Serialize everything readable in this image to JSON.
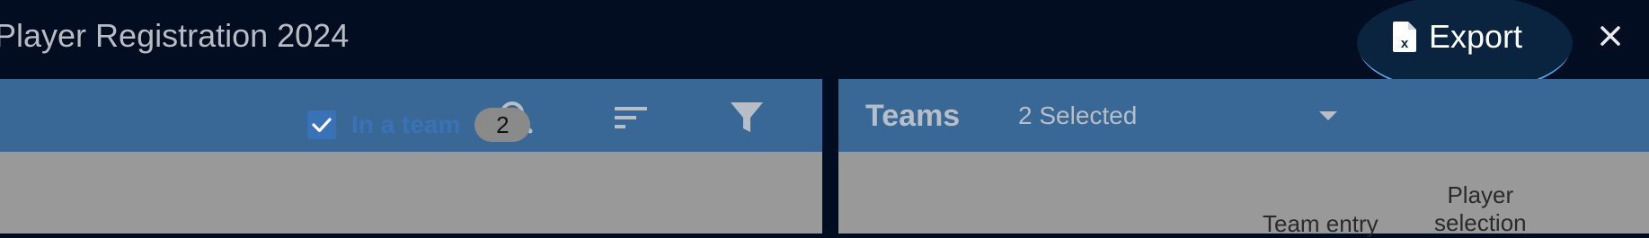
{
  "header": {
    "title": "Player Registration 2024",
    "export_label": "Export",
    "export_icon": "excel-file-icon",
    "close_icon": "close-icon"
  },
  "left_toolbar": {
    "icons": [
      "search-icon",
      "sort-icon",
      "filter-icon"
    ]
  },
  "filter": {
    "checked": true,
    "label": "In a team",
    "count": "2"
  },
  "right_toolbar": {
    "title": "Teams",
    "select_value": "2 Selected"
  },
  "table": {
    "columns": [
      {
        "line1": "",
        "line2": "Team entry"
      },
      {
        "line1": "Player",
        "line2": "selection"
      }
    ]
  },
  "colors": {
    "topbar": "#020d21",
    "toolbar": "#3a6896",
    "body": "#999999",
    "accent": "#3a72b8",
    "export_glow": "#5aa9f0"
  }
}
